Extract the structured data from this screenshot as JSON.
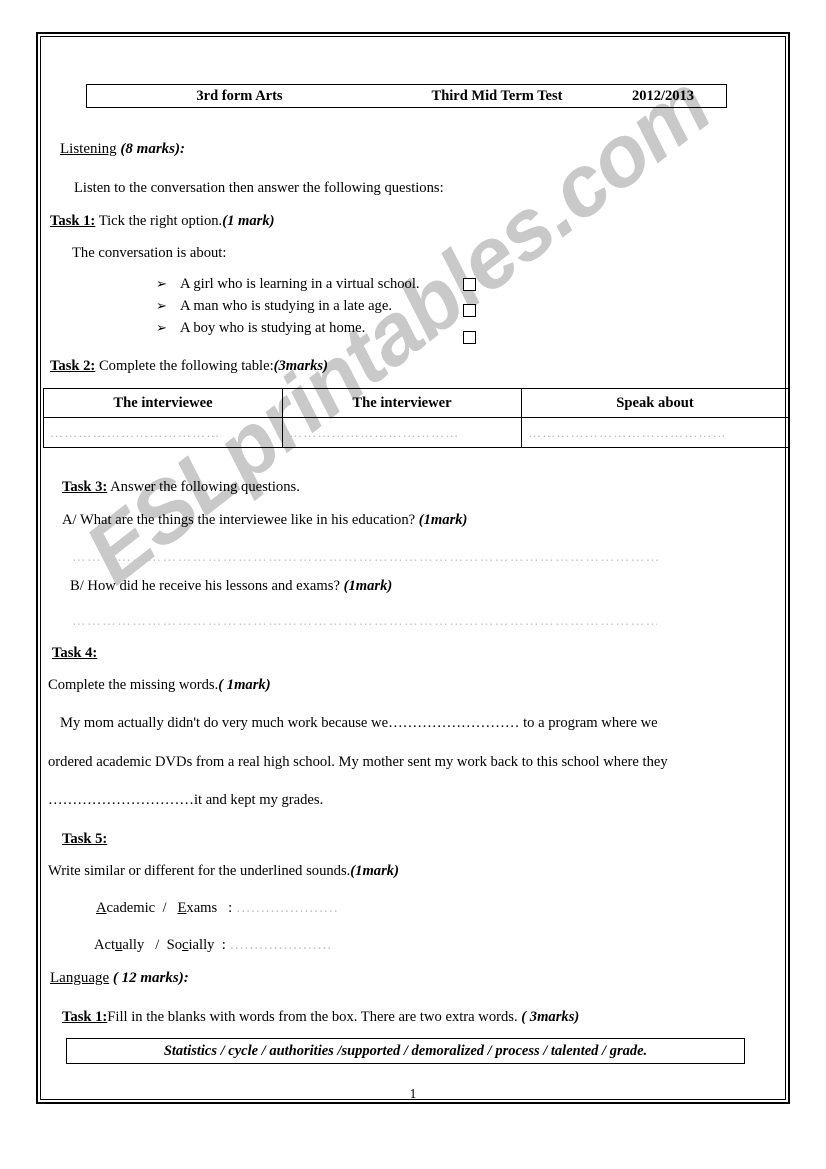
{
  "document": {
    "page_number": "1",
    "watermark": "ESLprintables.com"
  },
  "header": {
    "form": "3rd form Arts",
    "test_name": "Third Mid Term Test",
    "year": "2012/2013"
  },
  "listening": {
    "section_name": "Listening",
    "section_marks": "(8 marks):",
    "instruction": "Listen to the conversation then answer the following questions:",
    "task1": {
      "label": "Task 1:",
      "text": "Tick the right option.",
      "marks": "(1 mark)",
      "prompt": "The conversation is about:",
      "bullet": "➢",
      "options": [
        "A girl who is learning in a virtual school.",
        "A man who is studying in a late age.",
        "A boy who is studying at home."
      ]
    },
    "task2": {
      "label": "Task 2:",
      "text": "Complete the following table:",
      "marks": "(3marks)",
      "columns": [
        "The interviewee",
        "The interviewer",
        "Speak about"
      ],
      "answer_dots": [
        "………………………………",
        "………………………………",
        "……………………………………"
      ]
    },
    "task3": {
      "label": "Task 3:",
      "text": "Answer the following questions.",
      "question_a": "A/ What are the things the interviewee like in his education?",
      "question_a_marks": "(1mark)",
      "question_b": "B/ How did he receive his lessons and exams?",
      "question_b_marks": "(1mark)",
      "answer_line": "…………………………………………………………………………………………………………………………………………………"
    },
    "task4": {
      "label": "Task 4:",
      "text": "Complete the missing words.",
      "marks": "( 1mark)",
      "paragraph_line1_a": "My mom actually didn't do very much work because we",
      "paragraph_line1_blank": "………………………",
      "paragraph_line1_b": " to a program where we",
      "paragraph_line2": "ordered academic DVDs from a real high school.  My mother sent my work back to this school where they",
      "paragraph_line3_blank": "…………………………",
      "paragraph_line3_b": "it and kept my grades."
    },
    "task5": {
      "label": "Task 5:",
      "text": "Write similar or different for the underlined sounds.",
      "marks": "(1mark)",
      "pairs": [
        {
          "word1_underlined": "A",
          "word1_rest": "cademic",
          "separator": "/",
          "word2_underlined": "E",
          "word2_rest": "xams",
          "colon": ":",
          "dots": "…………………"
        },
        {
          "word1_pre": "Act",
          "word1_underlined": "u",
          "word1_post": "ally",
          "separator": "/",
          "word2_pre": "So",
          "word2_underlined": "c",
          "word2_post": "ially",
          "colon": ":",
          "dots": "…………………"
        }
      ]
    }
  },
  "language": {
    "section_name": "Language",
    "section_marks": "( 12 marks):",
    "task1": {
      "label": "Task 1:",
      "text": "Fill in the blanks with words from the box. There are two extra words.",
      "marks": "( 3marks)",
      "word_bank": "Statistics / cycle / authorities /supported / demoralized / process / talented / grade."
    }
  }
}
